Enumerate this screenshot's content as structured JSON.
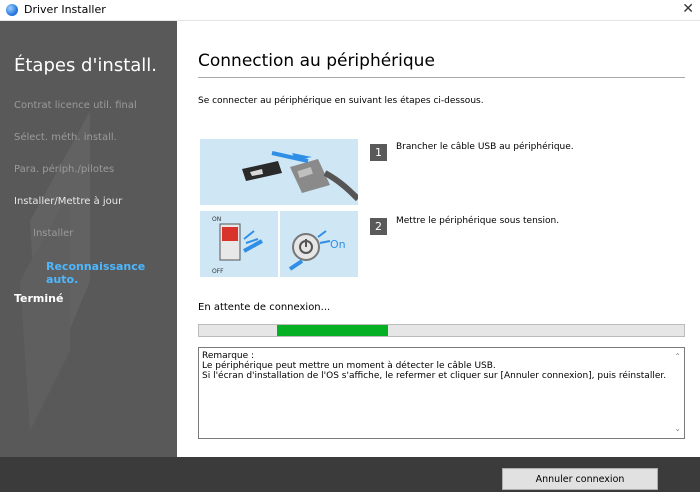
{
  "window": {
    "title": "Driver Installer",
    "close_glyph": "✕"
  },
  "sidebar": {
    "title": "Étapes d'install.",
    "steps": [
      {
        "label": "Contrat licence util. final",
        "state": "dim"
      },
      {
        "label": "Sélect. méth. install.",
        "state": "dim"
      },
      {
        "label": "Para. périph./pilotes",
        "state": "dim"
      },
      {
        "label": "Installer/Mettre à jour",
        "state": "bright"
      },
      {
        "label": "Installer",
        "state": "dim"
      },
      {
        "label": "Reconnaissance auto.",
        "state": "active"
      },
      {
        "label": "Terminé",
        "state": "done"
      }
    ]
  },
  "main": {
    "title": "Connection au périphérique",
    "intro": "Se connecter au périphérique en suivant les étapes ci-dessous.",
    "steps": [
      {
        "number": "1",
        "text": "Brancher le câble USB au périphérique.",
        "icon": "usb-cable-illustration"
      },
      {
        "number": "2",
        "text": "Mettre le périphérique sous tension.",
        "icon": "power-switch-illustration"
      }
    ],
    "power_on_label": "On",
    "switch_on_label": "ON",
    "switch_off_label": "OFF",
    "waiting_text": "En attente de connexion...",
    "progress": {
      "fill_start": 0.16,
      "fill_end": 0.39,
      "color": "#06b025"
    },
    "note": {
      "lines": [
        "Remarque :",
        "Le périphérique peut mettre un moment à détecter le câble USB.",
        "Si l'écran d'installation de l'OS s'affiche, le refermer et cliquer sur [Annuler connexion], puis réinstaller."
      ]
    }
  },
  "footer": {
    "cancel_label": "Annuler connexion"
  },
  "colors": {
    "sidebar_bg": "#595959",
    "footer_bg": "#3b3b3b",
    "active_step": "#4db8ff",
    "illustration_bg": "#cfe6f5"
  }
}
